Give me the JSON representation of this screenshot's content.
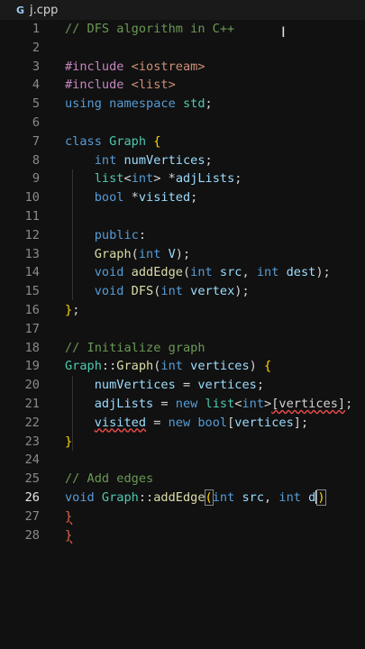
{
  "tab": {
    "filename": "j.cpp",
    "icon": "G"
  },
  "lines": [
    {
      "n": "1",
      "segs": [
        [
          "cm",
          "// DFS algorithm in C++"
        ]
      ]
    },
    {
      "n": "2",
      "segs": []
    },
    {
      "n": "3",
      "segs": [
        [
          "pre",
          "#include "
        ],
        [
          "str",
          "<iostream>"
        ]
      ]
    },
    {
      "n": "4",
      "segs": [
        [
          "pre",
          "#include "
        ],
        [
          "str",
          "<list>"
        ]
      ]
    },
    {
      "n": "5",
      "segs": [
        [
          "kw",
          "using namespace "
        ],
        [
          "cls",
          "std"
        ],
        [
          "pun",
          ";"
        ]
      ]
    },
    {
      "n": "6",
      "segs": []
    },
    {
      "n": "7",
      "segs": [
        [
          "kw",
          "class "
        ],
        [
          "cls",
          "Graph "
        ],
        [
          "br1",
          "{"
        ]
      ]
    },
    {
      "n": "8",
      "segs": [
        [
          "pun",
          "    "
        ],
        [
          "kw",
          "int "
        ],
        [
          "var",
          "numVertices"
        ],
        [
          "pun",
          ";"
        ]
      ]
    },
    {
      "n": "9",
      "segs": [
        [
          "pun",
          "    "
        ],
        [
          "cls",
          "list"
        ],
        [
          "pun",
          "<"
        ],
        [
          "kw",
          "int"
        ],
        [
          "pun",
          "> *"
        ],
        [
          "var",
          "adjLists"
        ],
        [
          "pun",
          ";"
        ]
      ]
    },
    {
      "n": "10",
      "segs": [
        [
          "pun",
          "    "
        ],
        [
          "kw",
          "bool "
        ],
        [
          "pun",
          "*"
        ],
        [
          "var",
          "visited"
        ],
        [
          "pun",
          ";"
        ]
      ]
    },
    {
      "n": "11",
      "segs": []
    },
    {
      "n": "12",
      "segs": [
        [
          "pun",
          "    "
        ],
        [
          "kw",
          "public"
        ],
        [
          "pun",
          ":"
        ]
      ]
    },
    {
      "n": "13",
      "segs": [
        [
          "pun",
          "    "
        ],
        [
          "fn",
          "Graph"
        ],
        [
          "pun",
          "("
        ],
        [
          "kw",
          "int "
        ],
        [
          "var",
          "V"
        ],
        [
          "pun",
          ");"
        ]
      ]
    },
    {
      "n": "14",
      "segs": [
        [
          "pun",
          "    "
        ],
        [
          "kw",
          "void "
        ],
        [
          "fn",
          "addEdge"
        ],
        [
          "pun",
          "("
        ],
        [
          "kw",
          "int "
        ],
        [
          "var",
          "src"
        ],
        [
          "pun",
          ", "
        ],
        [
          "kw",
          "int "
        ],
        [
          "var",
          "dest"
        ],
        [
          "pun",
          ");"
        ]
      ]
    },
    {
      "n": "15",
      "segs": [
        [
          "pun",
          "    "
        ],
        [
          "kw",
          "void "
        ],
        [
          "fn",
          "DFS"
        ],
        [
          "pun",
          "("
        ],
        [
          "kw",
          "int "
        ],
        [
          "var",
          "vertex"
        ],
        [
          "pun",
          ");"
        ]
      ]
    },
    {
      "n": "16",
      "segs": [
        [
          "br1",
          "}"
        ],
        [
          "pun",
          ";"
        ]
      ]
    },
    {
      "n": "17",
      "segs": []
    },
    {
      "n": "18",
      "segs": [
        [
          "cm",
          "// Initialize graph"
        ]
      ]
    },
    {
      "n": "19",
      "segs": [
        [
          "cls",
          "Graph"
        ],
        [
          "pun",
          "::"
        ],
        [
          "fn",
          "Graph"
        ],
        [
          "pun",
          "("
        ],
        [
          "kw",
          "int "
        ],
        [
          "var",
          "vertices"
        ],
        [
          "pun",
          ") "
        ],
        [
          "br1",
          "{"
        ]
      ]
    },
    {
      "n": "20",
      "segs": [
        [
          "pun",
          "    "
        ],
        [
          "var",
          "numVertices"
        ],
        [
          "pun",
          " = "
        ],
        [
          "var",
          "vertices"
        ],
        [
          "pun",
          ";"
        ]
      ]
    },
    {
      "n": "21",
      "segs": [
        [
          "pun",
          "    "
        ],
        [
          "var",
          "adjLists"
        ],
        [
          "pun",
          " = "
        ],
        [
          "kw",
          "new "
        ],
        [
          "cls",
          "list"
        ],
        [
          "pun",
          "<"
        ],
        [
          "kw",
          "int"
        ],
        [
          "pun",
          ">"
        ],
        [
          "sq",
          "[vertices]"
        ],
        [
          "pun",
          ";"
        ]
      ]
    },
    {
      "n": "22",
      "segs": [
        [
          "pun",
          "    "
        ],
        [
          "sqv",
          "visited"
        ],
        [
          "pun",
          " = "
        ],
        [
          "kw",
          "new "
        ],
        [
          "kw",
          "bool"
        ],
        [
          "pun",
          "["
        ],
        [
          "var",
          "vertices"
        ],
        [
          "pun",
          "];"
        ]
      ]
    },
    {
      "n": "23",
      "segs": [
        [
          "br1",
          "}"
        ]
      ]
    },
    {
      "n": "24",
      "segs": []
    },
    {
      "n": "25",
      "segs": [
        [
          "cm",
          "// Add edges"
        ]
      ]
    },
    {
      "n": "26",
      "segs": [
        [
          "kw",
          "void "
        ],
        [
          "cls",
          "Graph"
        ],
        [
          "pun",
          "::"
        ],
        [
          "fn",
          "addEdge"
        ],
        [
          "box",
          "("
        ],
        [
          "kw",
          "int "
        ],
        [
          "var",
          "src"
        ],
        [
          "pun",
          ", "
        ],
        [
          "kw",
          "int "
        ],
        [
          "var",
          "d"
        ],
        [
          "cur",
          ""
        ],
        [
          "box",
          ")"
        ]
      ],
      "current": true
    },
    {
      "n": "27",
      "segs": [
        [
          "err",
          "}"
        ]
      ]
    },
    {
      "n": "28",
      "segs": [
        [
          "err",
          "}"
        ]
      ]
    }
  ]
}
